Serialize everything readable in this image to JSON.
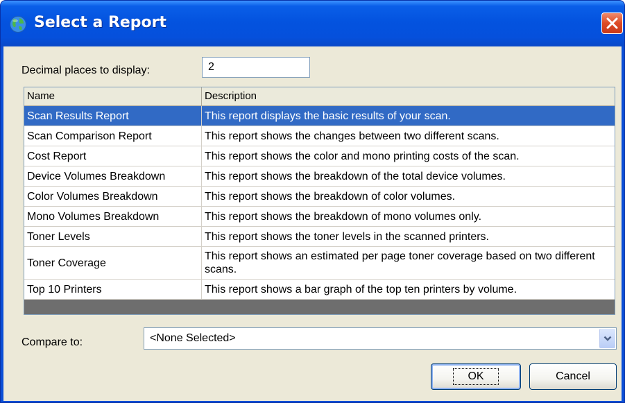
{
  "window": {
    "title": "Select a Report",
    "close_icon": "close-icon"
  },
  "decimal": {
    "label": "Decimal places to display:",
    "value": "2"
  },
  "grid": {
    "columns": [
      "Name",
      "Description"
    ],
    "selected_index": 0,
    "rows": [
      {
        "name": "Scan Results Report",
        "description": "This report displays the basic results of your scan."
      },
      {
        "name": "Scan Comparison Report",
        "description": "This report shows the changes between two different scans."
      },
      {
        "name": "Cost Report",
        "description": "This report shows the color and mono printing costs of the scan."
      },
      {
        "name": "Device Volumes Breakdown",
        "description": "This report shows the breakdown of the total device volumes."
      },
      {
        "name": "Color Volumes Breakdown",
        "description": "This report shows the breakdown of color volumes."
      },
      {
        "name": "Mono Volumes Breakdown",
        "description": "This report shows the breakdown of mono volumes only."
      },
      {
        "name": "Toner Levels",
        "description": "This report shows the toner levels in the scanned printers."
      },
      {
        "name": "Toner Coverage",
        "description": "This report shows an estimated per page toner coverage based on two different scans."
      },
      {
        "name": "Top 10 Printers",
        "description": "This report shows a bar graph of the top ten printers by volume."
      }
    ]
  },
  "compare": {
    "label": "Compare to:",
    "value": "<None Selected>"
  },
  "buttons": {
    "ok_label": "OK",
    "cancel_label": "Cancel"
  },
  "colors": {
    "titlebar": "#0453df",
    "selection": "#316ac5",
    "dialog_background": "#ece9d8"
  }
}
